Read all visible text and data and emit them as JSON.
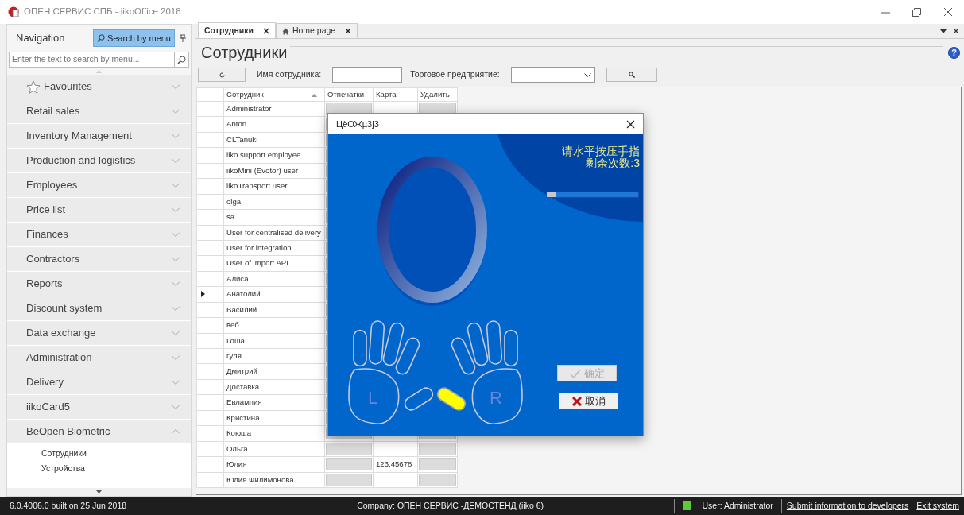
{
  "window": {
    "title": "ОПЕН СЕРВИС СПБ - iikoOffice 2018"
  },
  "navigation": {
    "title": "Navigation",
    "search_button": "Search by menu",
    "search_placeholder": "Enter the text to search by menu...",
    "items": [
      {
        "label": "Favourites",
        "kind": "favourites",
        "expanded": false
      },
      {
        "label": "Retail sales",
        "kind": "group",
        "expanded": false
      },
      {
        "label": "Inventory Management",
        "kind": "group",
        "expanded": false
      },
      {
        "label": "Production and logistics",
        "kind": "group",
        "expanded": false
      },
      {
        "label": "Employees",
        "kind": "group",
        "expanded": false
      },
      {
        "label": "Price list",
        "kind": "group",
        "expanded": false
      },
      {
        "label": "Finances",
        "kind": "group",
        "expanded": false
      },
      {
        "label": "Contractors",
        "kind": "group",
        "expanded": false
      },
      {
        "label": "Reports",
        "kind": "group",
        "expanded": false
      },
      {
        "label": "Discount system",
        "kind": "group",
        "expanded": false
      },
      {
        "label": "Data exchange",
        "kind": "group",
        "expanded": false
      },
      {
        "label": "Administration",
        "kind": "group",
        "expanded": false
      },
      {
        "label": "Delivery",
        "kind": "group",
        "expanded": false
      },
      {
        "label": "iikoCard5",
        "kind": "group",
        "expanded": false
      },
      {
        "label": "BeOpen Biometric",
        "kind": "group",
        "expanded": true,
        "children": [
          {
            "label": "Сотрудники"
          },
          {
            "label": "Устройства"
          }
        ]
      }
    ]
  },
  "tabs": [
    {
      "label": "Сотрудники",
      "kind": "page",
      "selected": true
    },
    {
      "label": "Home page",
      "kind": "home",
      "selected": false
    }
  ],
  "page": {
    "title": "Сотрудники",
    "help": "?",
    "employee_label": "Имя сотрудника:",
    "enterprise_label": "Торговое предприятие:"
  },
  "table": {
    "columns": [
      {
        "label": "Сотрудник",
        "sorted": true
      },
      {
        "label": "Отпечатки",
        "sorted": false
      },
      {
        "label": "Карта",
        "sorted": false
      },
      {
        "label": "Удалить",
        "sorted": false
      }
    ],
    "rows": [
      {
        "name": "Administrator",
        "selected": false
      },
      {
        "name": "Anton",
        "selected": false
      },
      {
        "name": "CLTanuki",
        "selected": false
      },
      {
        "name": "iiko support employee",
        "selected": false
      },
      {
        "name": "iikoMini (Evotor) user",
        "selected": false
      },
      {
        "name": "iikoTransport user",
        "selected": false
      },
      {
        "name": "olga",
        "selected": false
      },
      {
        "name": "sa",
        "selected": false
      },
      {
        "name": "User for centralised delivery",
        "selected": false
      },
      {
        "name": "User for integration",
        "selected": false
      },
      {
        "name": "User of import API",
        "selected": false
      },
      {
        "name": "Алиса",
        "selected": false
      },
      {
        "name": "Анатолий",
        "selected": true
      },
      {
        "name": "Василий",
        "selected": false
      },
      {
        "name": "веб",
        "selected": false
      },
      {
        "name": "Гоша",
        "selected": false
      },
      {
        "name": "гуля",
        "selected": false
      },
      {
        "name": "Дмитрий",
        "selected": false
      },
      {
        "name": "Доставка",
        "selected": false
      },
      {
        "name": "Евлампия",
        "selected": false
      },
      {
        "name": "Кристина",
        "selected": false
      },
      {
        "name": "Коюша",
        "selected": false
      },
      {
        "name": "Ольга",
        "selected": false
      },
      {
        "name": "Юлия",
        "card": "123,45678",
        "selected": false
      },
      {
        "name": "Юлия Филимонова",
        "selected": false
      }
    ]
  },
  "dialog": {
    "title": "ЦёОЖµ3j3",
    "prompt": [
      "请水平按压手指",
      "剩余次数:3"
    ],
    "level": 0.1,
    "left_thumb_lit": false,
    "right_thumb_lit": true,
    "left_label": "L",
    "right_label": "R",
    "buttons": [
      {
        "label": "确定",
        "kind": "ok",
        "disabled": true
      },
      {
        "label": "取消",
        "kind": "cancel",
        "disabled": false
      }
    ]
  },
  "status_bar": {
    "version": "6.0.4006.0 built on 25 Jun 2018",
    "company": "Company: ОПЕН СЕРВИС -ДЕМОСТЕНД (iiko 6)",
    "connected": true,
    "user": "User: Administrator",
    "links": [
      "Submit information to developers",
      "Exit system"
    ]
  }
}
